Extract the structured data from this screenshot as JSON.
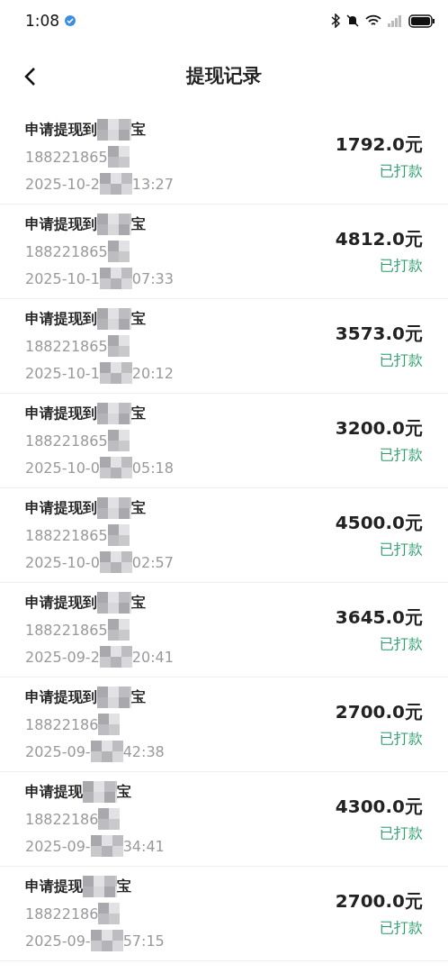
{
  "status_bar": {
    "time": "1:08"
  },
  "header": {
    "title": "提现记录"
  },
  "records": [
    {
      "title_start": "申请提现到",
      "title_end": "宝",
      "account": "188221865",
      "date_start": "2025-10-2",
      "time_end": "13:27",
      "amount": "1792.0元",
      "status": "已打款"
    },
    {
      "title_start": "申请提现到",
      "title_end": "宝",
      "account": "188221865",
      "date_start": "2025-10-1",
      "time_end": "07:33",
      "amount": "4812.0元",
      "status": "已打款"
    },
    {
      "title_start": "申请提现到",
      "title_end": "宝",
      "account": "188221865",
      "date_start": "2025-10-1",
      "time_end": "20:12",
      "amount": "3573.0元",
      "status": "已打款"
    },
    {
      "title_start": "申请提现到",
      "title_end": "宝",
      "account": "188221865",
      "date_start": "2025-10-0",
      "time_end": "05:18",
      "amount": "3200.0元",
      "status": "已打款"
    },
    {
      "title_start": "申请提现到",
      "title_end": "宝",
      "account": "188221865",
      "date_start": "2025-10-0",
      "time_end": "02:57",
      "amount": "4500.0元",
      "status": "已打款"
    },
    {
      "title_start": "申请提现到",
      "title_end": "宝",
      "account": "188221865",
      "date_start": "2025-09-2",
      "time_end": "20:41",
      "amount": "3645.0元",
      "status": "已打款"
    },
    {
      "title_start": "申请提现到",
      "title_end": "宝",
      "account": "18822186",
      "date_start": "2025-09-",
      "time_end": "42:38",
      "amount": "2700.0元",
      "status": "已打款"
    },
    {
      "title_start": "申请提现",
      "title_end": "宝",
      "account": "18822186",
      "date_start": "2025-09-",
      "time_end": "34:41",
      "amount": "4300.0元",
      "status": "已打款"
    },
    {
      "title_start": "申请提现",
      "title_end": "宝",
      "account": "18822186",
      "date_start": "2025-09-",
      "time_end": "57:15",
      "amount": "2700.0元",
      "status": "已打款"
    }
  ]
}
